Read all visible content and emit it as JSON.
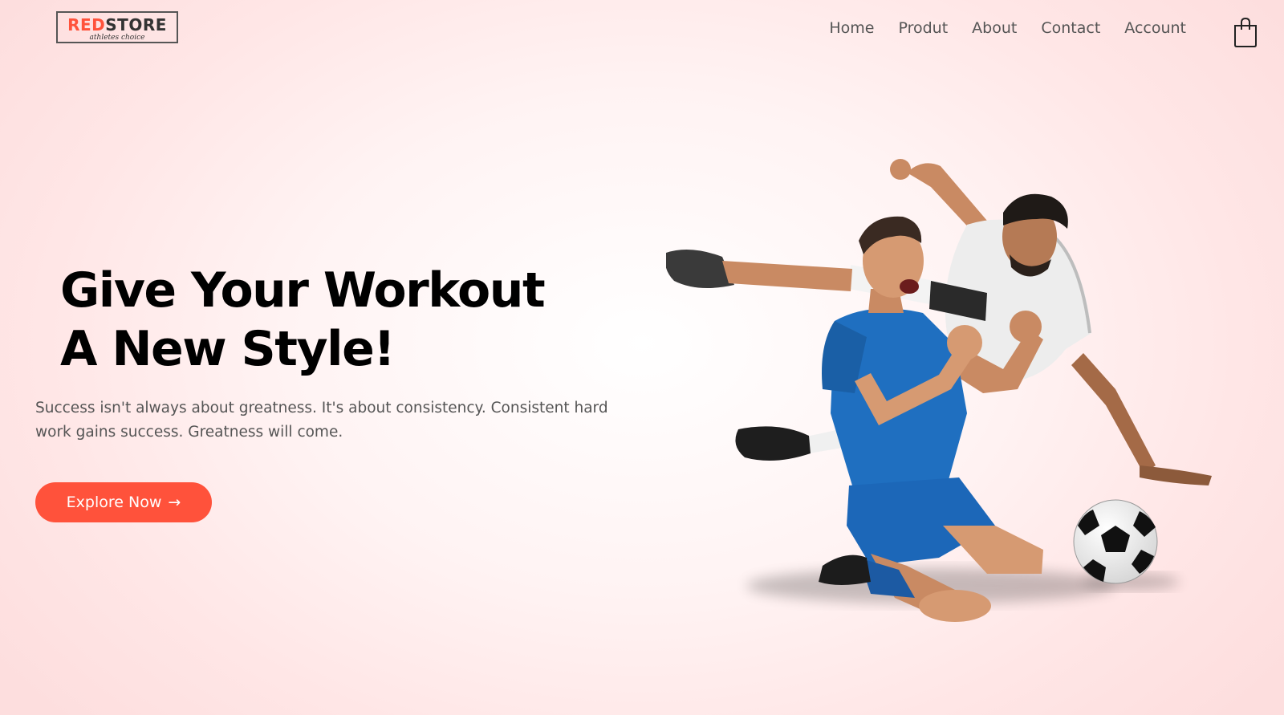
{
  "header": {
    "logo": {
      "brand_red": "RED",
      "brand_dark": "STORE",
      "tagline": "athletes choice"
    },
    "nav": [
      {
        "label": "Home"
      },
      {
        "label": "Produt"
      },
      {
        "label": "About"
      },
      {
        "label": "Contact"
      },
      {
        "label": "Account"
      }
    ],
    "cart_icon": "shopping-bag-icon"
  },
  "hero": {
    "headline_line1": "Give Your Workout",
    "headline_line2": "A New Style!",
    "subtext": "Success isn't always about greatness. It's about consistency. Consistent hard work gains success. Greatness will come.",
    "cta_label": "Explore Now",
    "cta_arrow": "→",
    "image_subject": "two soccer players celebrating with a ball"
  },
  "colors": {
    "accent": "#ff523b",
    "text_dark": "#000000",
    "text_muted": "#555555",
    "background": "#ffe6e6"
  }
}
